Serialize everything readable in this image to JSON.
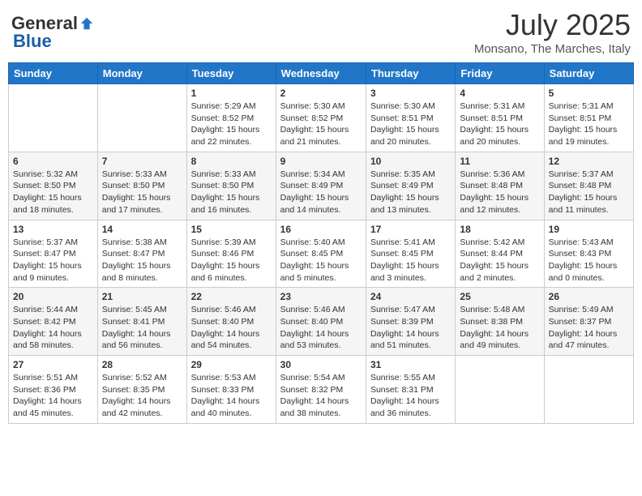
{
  "header": {
    "logo_general": "General",
    "logo_blue": "Blue",
    "month_title": "July 2025",
    "subtitle": "Monsano, The Marches, Italy"
  },
  "weekdays": [
    "Sunday",
    "Monday",
    "Tuesday",
    "Wednesday",
    "Thursday",
    "Friday",
    "Saturday"
  ],
  "weeks": [
    [
      {
        "day": "",
        "sunrise": "",
        "sunset": "",
        "daylight": ""
      },
      {
        "day": "",
        "sunrise": "",
        "sunset": "",
        "daylight": ""
      },
      {
        "day": "1",
        "sunrise": "Sunrise: 5:29 AM",
        "sunset": "Sunset: 8:52 PM",
        "daylight": "Daylight: 15 hours and 22 minutes."
      },
      {
        "day": "2",
        "sunrise": "Sunrise: 5:30 AM",
        "sunset": "Sunset: 8:52 PM",
        "daylight": "Daylight: 15 hours and 21 minutes."
      },
      {
        "day": "3",
        "sunrise": "Sunrise: 5:30 AM",
        "sunset": "Sunset: 8:51 PM",
        "daylight": "Daylight: 15 hours and 20 minutes."
      },
      {
        "day": "4",
        "sunrise": "Sunrise: 5:31 AM",
        "sunset": "Sunset: 8:51 PM",
        "daylight": "Daylight: 15 hours and 20 minutes."
      },
      {
        "day": "5",
        "sunrise": "Sunrise: 5:31 AM",
        "sunset": "Sunset: 8:51 PM",
        "daylight": "Daylight: 15 hours and 19 minutes."
      }
    ],
    [
      {
        "day": "6",
        "sunrise": "Sunrise: 5:32 AM",
        "sunset": "Sunset: 8:50 PM",
        "daylight": "Daylight: 15 hours and 18 minutes."
      },
      {
        "day": "7",
        "sunrise": "Sunrise: 5:33 AM",
        "sunset": "Sunset: 8:50 PM",
        "daylight": "Daylight: 15 hours and 17 minutes."
      },
      {
        "day": "8",
        "sunrise": "Sunrise: 5:33 AM",
        "sunset": "Sunset: 8:50 PM",
        "daylight": "Daylight: 15 hours and 16 minutes."
      },
      {
        "day": "9",
        "sunrise": "Sunrise: 5:34 AM",
        "sunset": "Sunset: 8:49 PM",
        "daylight": "Daylight: 15 hours and 14 minutes."
      },
      {
        "day": "10",
        "sunrise": "Sunrise: 5:35 AM",
        "sunset": "Sunset: 8:49 PM",
        "daylight": "Daylight: 15 hours and 13 minutes."
      },
      {
        "day": "11",
        "sunrise": "Sunrise: 5:36 AM",
        "sunset": "Sunset: 8:48 PM",
        "daylight": "Daylight: 15 hours and 12 minutes."
      },
      {
        "day": "12",
        "sunrise": "Sunrise: 5:37 AM",
        "sunset": "Sunset: 8:48 PM",
        "daylight": "Daylight: 15 hours and 11 minutes."
      }
    ],
    [
      {
        "day": "13",
        "sunrise": "Sunrise: 5:37 AM",
        "sunset": "Sunset: 8:47 PM",
        "daylight": "Daylight: 15 hours and 9 minutes."
      },
      {
        "day": "14",
        "sunrise": "Sunrise: 5:38 AM",
        "sunset": "Sunset: 8:47 PM",
        "daylight": "Daylight: 15 hours and 8 minutes."
      },
      {
        "day": "15",
        "sunrise": "Sunrise: 5:39 AM",
        "sunset": "Sunset: 8:46 PM",
        "daylight": "Daylight: 15 hours and 6 minutes."
      },
      {
        "day": "16",
        "sunrise": "Sunrise: 5:40 AM",
        "sunset": "Sunset: 8:45 PM",
        "daylight": "Daylight: 15 hours and 5 minutes."
      },
      {
        "day": "17",
        "sunrise": "Sunrise: 5:41 AM",
        "sunset": "Sunset: 8:45 PM",
        "daylight": "Daylight: 15 hours and 3 minutes."
      },
      {
        "day": "18",
        "sunrise": "Sunrise: 5:42 AM",
        "sunset": "Sunset: 8:44 PM",
        "daylight": "Daylight: 15 hours and 2 minutes."
      },
      {
        "day": "19",
        "sunrise": "Sunrise: 5:43 AM",
        "sunset": "Sunset: 8:43 PM",
        "daylight": "Daylight: 15 hours and 0 minutes."
      }
    ],
    [
      {
        "day": "20",
        "sunrise": "Sunrise: 5:44 AM",
        "sunset": "Sunset: 8:42 PM",
        "daylight": "Daylight: 14 hours and 58 minutes."
      },
      {
        "day": "21",
        "sunrise": "Sunrise: 5:45 AM",
        "sunset": "Sunset: 8:41 PM",
        "daylight": "Daylight: 14 hours and 56 minutes."
      },
      {
        "day": "22",
        "sunrise": "Sunrise: 5:46 AM",
        "sunset": "Sunset: 8:40 PM",
        "daylight": "Daylight: 14 hours and 54 minutes."
      },
      {
        "day": "23",
        "sunrise": "Sunrise: 5:46 AM",
        "sunset": "Sunset: 8:40 PM",
        "daylight": "Daylight: 14 hours and 53 minutes."
      },
      {
        "day": "24",
        "sunrise": "Sunrise: 5:47 AM",
        "sunset": "Sunset: 8:39 PM",
        "daylight": "Daylight: 14 hours and 51 minutes."
      },
      {
        "day": "25",
        "sunrise": "Sunrise: 5:48 AM",
        "sunset": "Sunset: 8:38 PM",
        "daylight": "Daylight: 14 hours and 49 minutes."
      },
      {
        "day": "26",
        "sunrise": "Sunrise: 5:49 AM",
        "sunset": "Sunset: 8:37 PM",
        "daylight": "Daylight: 14 hours and 47 minutes."
      }
    ],
    [
      {
        "day": "27",
        "sunrise": "Sunrise: 5:51 AM",
        "sunset": "Sunset: 8:36 PM",
        "daylight": "Daylight: 14 hours and 45 minutes."
      },
      {
        "day": "28",
        "sunrise": "Sunrise: 5:52 AM",
        "sunset": "Sunset: 8:35 PM",
        "daylight": "Daylight: 14 hours and 42 minutes."
      },
      {
        "day": "29",
        "sunrise": "Sunrise: 5:53 AM",
        "sunset": "Sunset: 8:33 PM",
        "daylight": "Daylight: 14 hours and 40 minutes."
      },
      {
        "day": "30",
        "sunrise": "Sunrise: 5:54 AM",
        "sunset": "Sunset: 8:32 PM",
        "daylight": "Daylight: 14 hours and 38 minutes."
      },
      {
        "day": "31",
        "sunrise": "Sunrise: 5:55 AM",
        "sunset": "Sunset: 8:31 PM",
        "daylight": "Daylight: 14 hours and 36 minutes."
      },
      {
        "day": "",
        "sunrise": "",
        "sunset": "",
        "daylight": ""
      },
      {
        "day": "",
        "sunrise": "",
        "sunset": "",
        "daylight": ""
      }
    ]
  ]
}
